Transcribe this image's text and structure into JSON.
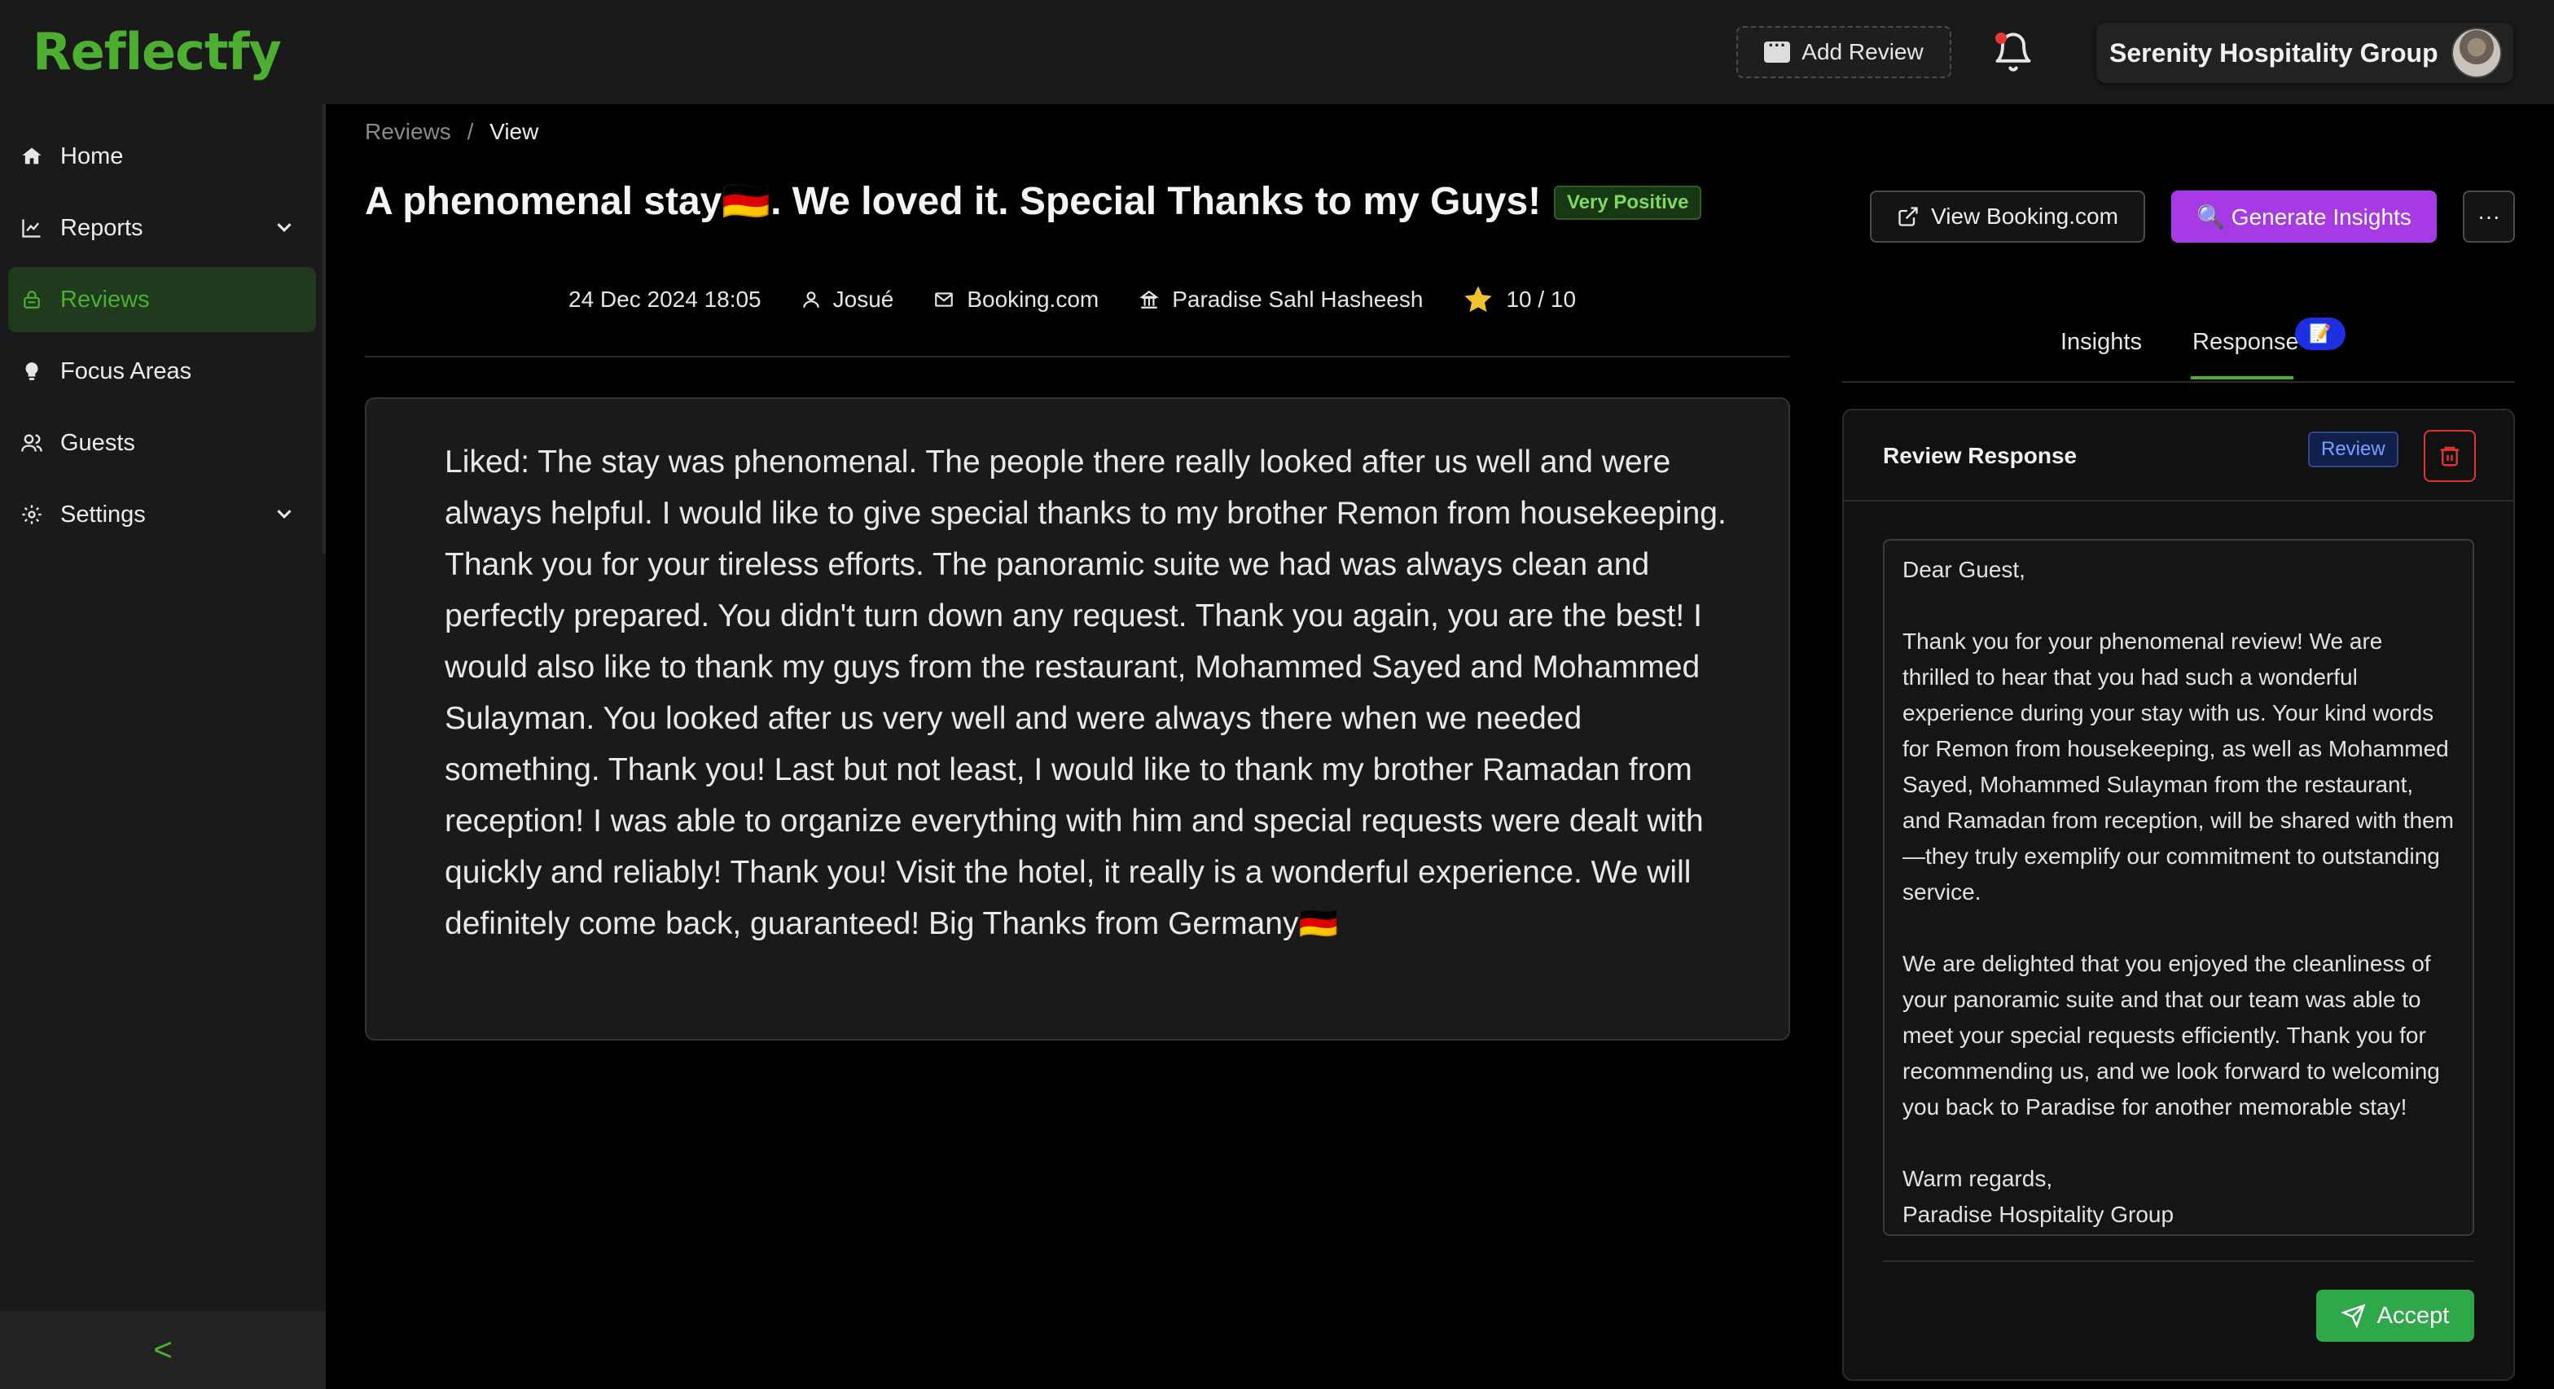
{
  "app": {
    "logo": "Reflectfy"
  },
  "header": {
    "add_review_label": "Add Review",
    "account_name": "Serenity Hospitality Group"
  },
  "sidebar": {
    "items": [
      {
        "label": "Home",
        "icon": "home-icon"
      },
      {
        "label": "Reports",
        "icon": "chart-icon",
        "expandable": true
      },
      {
        "label": "Reviews",
        "icon": "lock-icon",
        "active": true
      },
      {
        "label": "Focus Areas",
        "icon": "bulb-icon"
      },
      {
        "label": "Guests",
        "icon": "users-icon"
      },
      {
        "label": "Settings",
        "icon": "gear-icon",
        "expandable": true
      }
    ],
    "collapse_icon": "<"
  },
  "breadcrumb": {
    "root": "Reviews",
    "separator": "/",
    "current": "View"
  },
  "review": {
    "title": "A phenomenal stay🇩🇪. We loved it. Special Thanks to my Guys!",
    "sentiment": "Very Positive",
    "date": "24 Dec 2024 18:05",
    "guest": "Josué",
    "source": "Booking.com",
    "property": "Paradise Sahl Hasheesh",
    "rating": "10 / 10",
    "body": "Liked: The stay was phenomenal. The people there really looked after us well and were always helpful. I would like to give special thanks to my brother Remon from housekeeping. Thank you for your tireless efforts. The panoramic suite we had was always clean and perfectly prepared. You didn't turn down any request. Thank you again, you are the best! I would also like to thank my guys from the restaurant, Mohammed Sayed and Mohammed Sulayman. You looked after us very well and were always there when we needed something. Thank you! Last but not least, I would like to thank my brother Ramadan from reception! I was able to organize everything with him and special requests were dealt with quickly and reliably! Thank you! Visit the hotel, it really is a wonderful experience. We will definitely come back, guaranteed! Big Thanks from Germany🇩🇪"
  },
  "actions": {
    "view_source": "View Booking.com",
    "generate": "🔍 Generate Insights",
    "more": "···"
  },
  "tabs": [
    {
      "label": "Insights"
    },
    {
      "label": "Response",
      "active": true,
      "badge": "📝"
    }
  ],
  "response": {
    "title": "Review Response",
    "status": "Review",
    "text": "Dear Guest,\n\nThank you for your phenomenal review! We are thrilled to hear that you had such a wonderful experience during your stay with us. Your kind words for Remon from housekeeping, as well as Mohammed Sayed, Mohammed Sulayman from the restaurant, and Ramadan from reception, will be shared with them—they truly exemplify our commitment to outstanding service.\n\nWe are delighted that you enjoyed the cleanliness of your panoramic suite and that our team was able to meet your special requests efficiently. Thank you for recommending us, and we look forward to welcoming you back to Paradise for another memorable stay!\n\nWarm regards,\nParadise Hospitality Group",
    "accept_label": "Accept"
  },
  "colors": {
    "brand_green": "#4caf30",
    "generate_purple": "#a63be6",
    "accept_green": "#2fa84a",
    "delete_red": "#dd3333"
  }
}
